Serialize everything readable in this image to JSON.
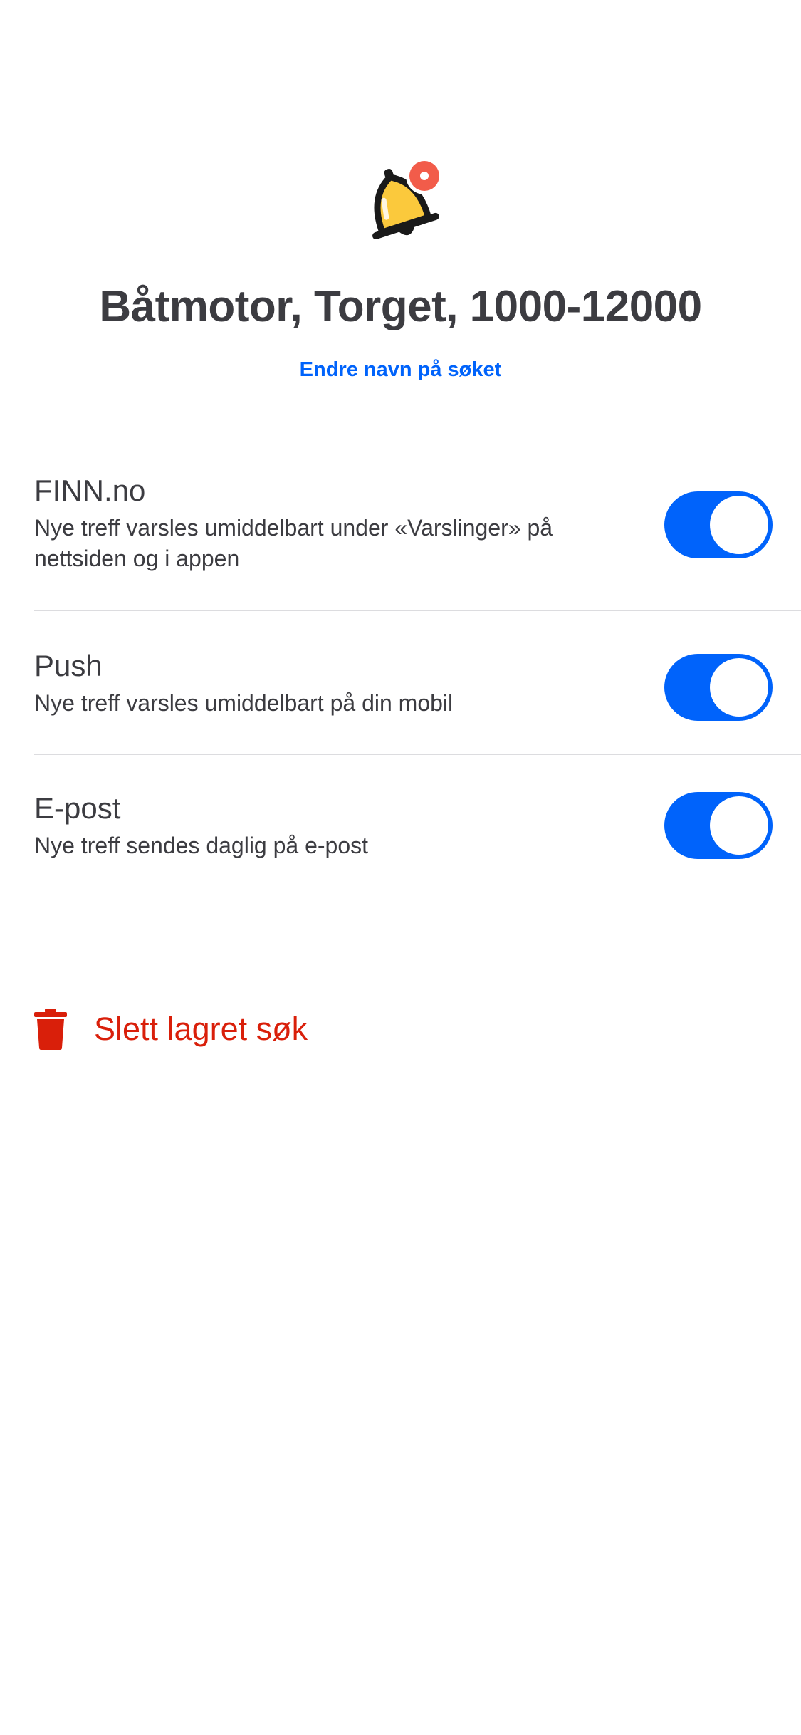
{
  "saved_search": {
    "title": "Båtmotor, Torget, 1000-12000",
    "rename_label": "Endre navn på søket"
  },
  "notifications": [
    {
      "title": "FINN.no",
      "description": "Nye treff varsles umiddelbart under «Varslinger» på nettsiden og i appen",
      "enabled": true
    },
    {
      "title": "Push",
      "description": "Nye treff varsles umiddelbart på din mobil",
      "enabled": true
    },
    {
      "title": "E-post",
      "description": "Nye treff sendes daglig på e-post",
      "enabled": true
    }
  ],
  "delete": {
    "label": "Slett lagret søk"
  },
  "colors": {
    "accent": "#0063fb",
    "danger": "#d91f0a",
    "text": "#3c3c41",
    "bell": "#fbc93c",
    "badge": "#f25c4a"
  },
  "icons": {
    "header": "bell-notification-icon",
    "delete": "trash-icon"
  }
}
